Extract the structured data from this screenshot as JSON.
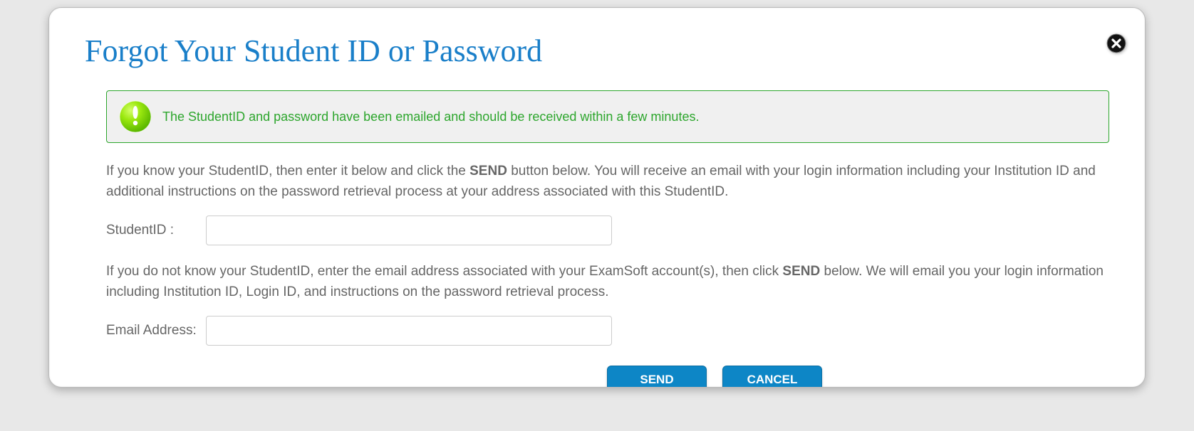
{
  "modal": {
    "title": "Forgot Your Student ID or Password",
    "alert": "The StudentID and password have been emailed and should be received within a few minutes.",
    "instruction1_pre": "If you know your StudentID, then enter it below and click the ",
    "instruction1_bold": "SEND",
    "instruction1_post": " button below. You will receive an email with your login information including your Institution ID and additional instructions on the password retrieval process at your address associated with this StudentID.",
    "studentid_label": "StudentID :",
    "studentid_value": "",
    "instruction2_pre": "If you do not know your StudentID, enter the email address associated with your ExamSoft account(s), then click ",
    "instruction2_bold": "SEND",
    "instruction2_post": " below. We will email you your login information including Institution ID, Login ID, and instructions on the password retrieval process.",
    "email_label": "Email Address:",
    "email_value": "",
    "send_label": "SEND",
    "cancel_label": "CANCEL"
  }
}
